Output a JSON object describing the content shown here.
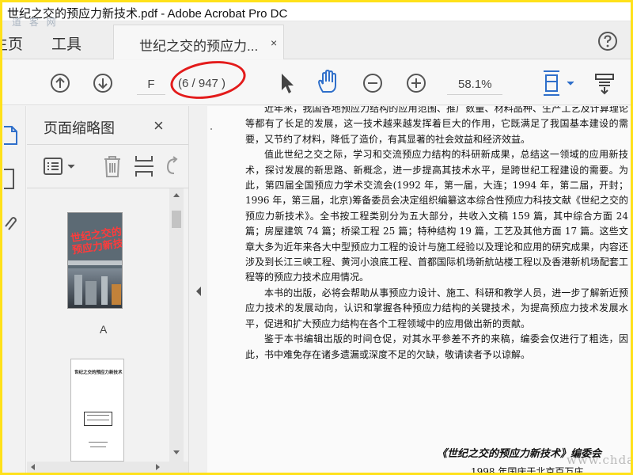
{
  "window": {
    "title": "世纪之交的预应力新技术.pdf - Adobe Acrobat Pro DC",
    "watermark_top": "道 客 网"
  },
  "tabs": {
    "home": "主页",
    "tools": "工具",
    "document": "世纪之交的预应力...",
    "document_close": "×"
  },
  "toolbar": {
    "page_value": "F",
    "page_total": "/ 947 )",
    "page_current_hint": "6",
    "zoom": "58.1%",
    "accent": "#2f6fca"
  },
  "thumbnail_panel": {
    "title": "页面缩略图",
    "close": "×",
    "page1_label": "A",
    "page1_cover_title": "世纪之交的\n预应力新技术",
    "page2_title": "世纪之交的预应力新技术"
  },
  "document": {
    "para1_cont": "近年来，我国各地预应力结构的应用范围、推广数量、材料品种、生产工艺及计算理论等都有了长足的发展，这一技术越来越发挥着巨大的作用，它既满足了我国基本建设的需要，又节约了材料，降低了造价，有其显著的社会效益和经济效益。",
    "para2": "值此世纪之交之际，学习和交流预应力结构的科研新成果，总结这一领域的应用新技术，探讨发展的新思路、新概念，进一步提高其技术水平，是跨世纪工程建设的需要。为此，第四届全国预应力学术交流会(1992 年，第一届，大连；1994 年，第二届，开封；1996 年，第三届，北京)筹备委员会决定组织编纂这本综合性预应力科技文献《世纪之交的预应力新技术》。全书按工程类别分为五大部分，共收入文稿 159 篇，其中综合方面 24 篇；房屋建筑 74 篇；桥梁工程 25 篇；特种结构 19 篇，工艺及其他方面 17 篇。这些文章大多为近年来各大中型预应力工程的设计与施工经验以及理论和应用的研究成果，内容还涉及到长江三峡工程、黄河小浪底工程、首都国际机场新航站楼工程以及香港新机场配套工程等的预应力技术应用情况。",
    "para3": "本书的出版，必将会帮助从事预应力设计、施工、科研和教学人员，进一步了解新近预应力技术的发展动向，认识和掌握各种预应力结构的关键技术，为提高预应力技术发展水平，促进和扩大预应力结构在各个工程领域中的应用做出新的贡献。",
    "para4": "鉴于本书编辑出版的时间仓促，对其水平参差不齐的来稿，编委会仅进行了粗选，因此，书中难免存在诸多遗漏或深度不足的欠缺，敬请读者予以谅解。",
    "signature": "《世纪之交的预应力新技术》编委会",
    "date_line": "1998 年国庆于北京百万庄",
    "watermark_bottom": "www.chdao.com"
  }
}
